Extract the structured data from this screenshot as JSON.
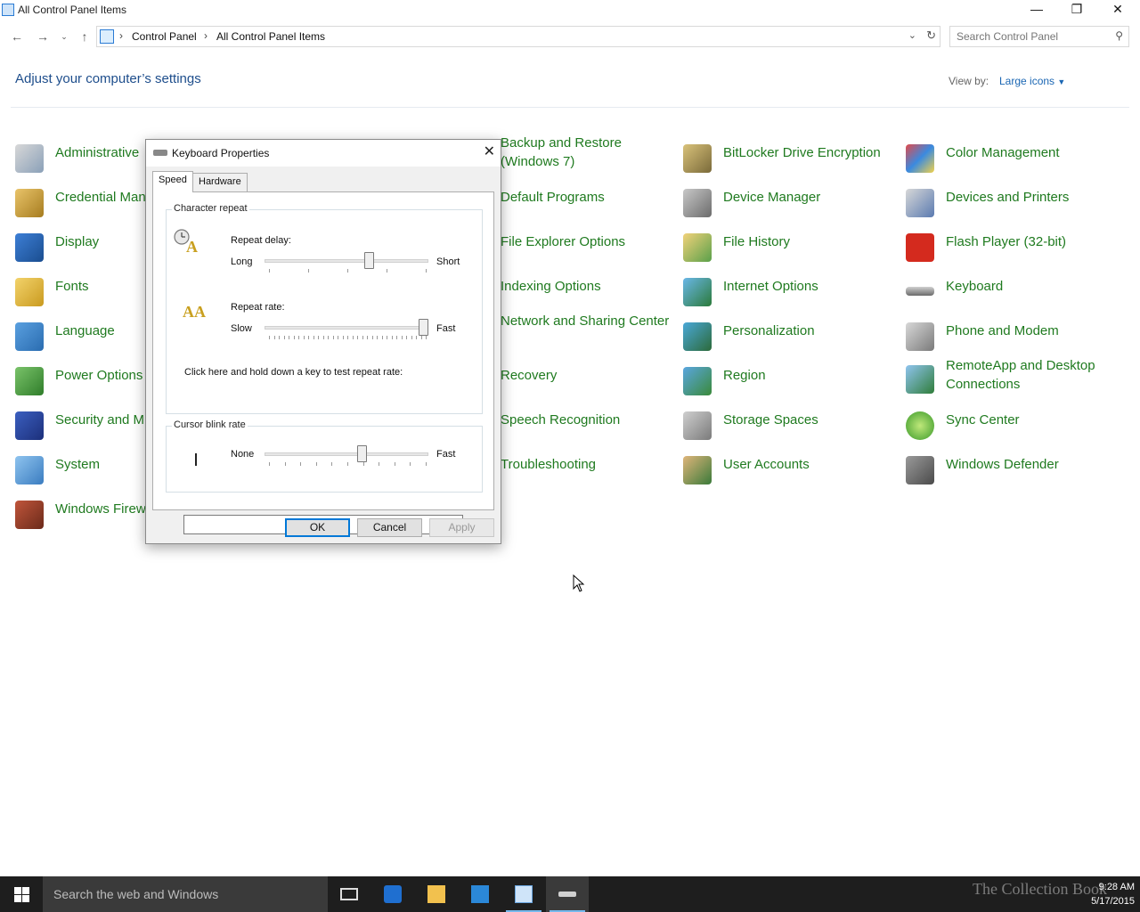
{
  "window": {
    "title": "All Control Panel Items"
  },
  "address": {
    "crumbs": [
      "Control Panel",
      "All Control Panel Items"
    ],
    "search_placeholder": "Search Control Panel"
  },
  "page": {
    "heading": "Adjust your computer’s settings",
    "view_by_label": "View by:",
    "view_by_value": "Large icons"
  },
  "items": {
    "col1": [
      "Administrative",
      "Credential Man",
      "Display",
      "Fonts",
      "Language",
      "Power Options",
      "Security and M",
      "System",
      "Windows Firew"
    ],
    "col2": [
      "Backup and Restore (Windows 7)",
      "Default Programs",
      "File Explorer Options",
      "Indexing Options",
      "Network and Sharing Center",
      "Recovery",
      "Speech Recognition",
      "Troubleshooting"
    ],
    "col3": [
      "BitLocker Drive Encryption",
      "Device Manager",
      "File History",
      "Internet Options",
      "Personalization",
      "Region",
      "Storage Spaces",
      "User Accounts"
    ],
    "col4": [
      "Color Management",
      "Devices and Printers",
      "Flash Player (32-bit)",
      "Keyboard",
      "Phone and Modem",
      "RemoteApp and Desktop Connections",
      "Sync Center",
      "Windows Defender"
    ]
  },
  "dialog": {
    "title": "Keyboard Properties",
    "tabs": [
      "Speed",
      "Hardware"
    ],
    "char_repeat": {
      "legend": "Character repeat",
      "delay_label": "Repeat delay:",
      "delay_low": "Long",
      "delay_high": "Short",
      "delay_value": 0.65,
      "rate_label": "Repeat rate:",
      "rate_low": "Slow",
      "rate_high": "Fast",
      "rate_value": 1.0,
      "test_label": "Click here and hold down a key to test repeat rate:"
    },
    "cursor_blink": {
      "legend": "Cursor blink rate",
      "low": "None",
      "high": "Fast",
      "value": 0.6
    },
    "buttons": {
      "ok": "OK",
      "cancel": "Cancel",
      "apply": "Apply"
    }
  },
  "taskbar": {
    "search_text": "Search the web and Windows",
    "watermark": "The Collection Book",
    "time": "9:28 AM",
    "date": "5/17/2015"
  },
  "colors": {
    "link_green": "#1f7a1f",
    "heading_blue": "#1e4e8c",
    "accent": "#0078d7"
  }
}
